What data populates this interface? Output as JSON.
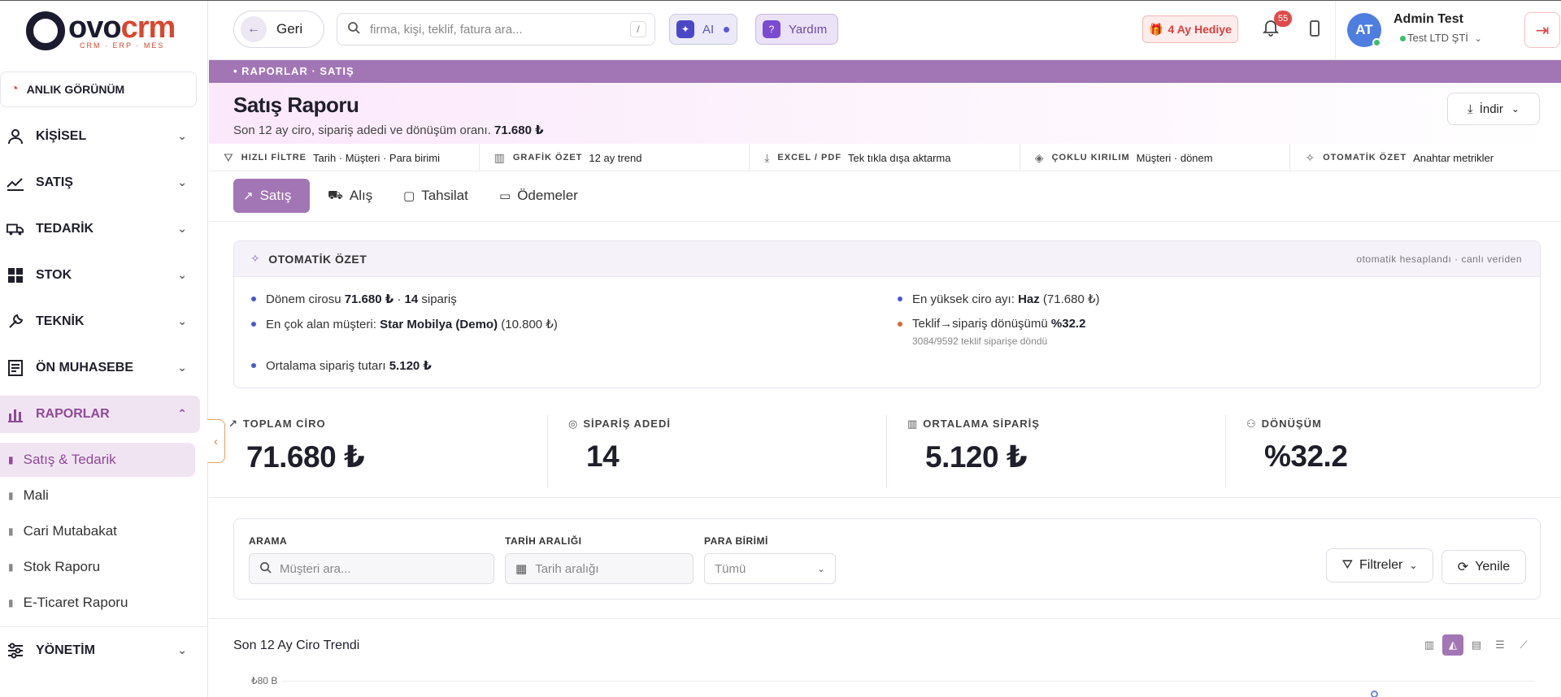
{
  "logo": {
    "main_left": "ovo",
    "main_right": "crm",
    "sub": "CRM · ERP · MES"
  },
  "sidebar": {
    "anlik_label": "ANLIK GÖRÜNÜM",
    "items": [
      {
        "label": "KİŞİSEL"
      },
      {
        "label": "SATIŞ"
      },
      {
        "label": "TEDARİK"
      },
      {
        "label": "STOK"
      },
      {
        "label": "TEKNİK"
      },
      {
        "label": "ÖN MUHASEBE"
      },
      {
        "label": "RAPORLAR"
      },
      {
        "label": "YÖNETİM"
      }
    ],
    "sub_items": [
      {
        "label": "Satış & Tedarik"
      },
      {
        "label": "Mali"
      },
      {
        "label": "Cari Mutabakat"
      },
      {
        "label": "Stok Raporu"
      },
      {
        "label": "E-Ticaret Raporu"
      }
    ]
  },
  "topbar": {
    "back_label": "Geri",
    "search_placeholder": "firma, kişi, teklif, fatura ara...",
    "search_shortcut": "/",
    "ai_label": "AI",
    "help_label": "Yardım",
    "gift_label": "4 Ay Hediye",
    "notification_count": "55",
    "avatar_initials": "AT",
    "user_name": "Admin Test",
    "company": "Test LTD ŞTİ"
  },
  "breadcrumb": "• RAPORLAR · SATIŞ",
  "header": {
    "title": "Satış Raporu",
    "subtitle": "Son 12 ay ciro, sipariş adedi ve dönüşüm oranı.",
    "subtitle_value": "71.680 ₺",
    "download_label": "İndir"
  },
  "features": [
    {
      "label": "HIZLI FİLTRE",
      "value": "Tarih · Müşteri · Para birimi"
    },
    {
      "label": "GRAFİK ÖZET",
      "value": "12 ay trend"
    },
    {
      "label": "EXCEL / PDF",
      "value": "Tek tıkla dışa aktarma"
    },
    {
      "label": "ÇOKLU KIRILIM",
      "value": "Müşteri · dönem"
    },
    {
      "label": "OTOMATİK ÖZET",
      "value": "Anahtar metrikler"
    }
  ],
  "tabs": [
    {
      "label": "Satış"
    },
    {
      "label": "Alış"
    },
    {
      "label": "Tahsilat"
    },
    {
      "label": "Ödemeler"
    }
  ],
  "summary": {
    "title": "OTOMATİK ÖZET",
    "note": "otomatik hesaplandı · canlı veriden",
    "b1_pre": "Dönem cirosu ",
    "b1_val": "71.680 ₺",
    "b1_mid": " · ",
    "b1_cnt": "14",
    "b1_post": " sipariş",
    "b2_pre": "En çok alan müşteri: ",
    "b2_val": "Star Mobilya (Demo)",
    "b2_post": " (10.800 ₺)",
    "b3_pre": "Ortalama sipariş tutarı ",
    "b3_val": "5.120 ₺",
    "b4_pre": "En yüksek ciro ayı: ",
    "b4_val": "Haz",
    "b4_post": " (71.680 ₺)",
    "b5_pre": "Teklif→sipariş dönüşümü ",
    "b5_val": "%32.2",
    "b5_sub": "3084/9592 teklif siparişe döndü"
  },
  "kpis": [
    {
      "label": "TOPLAM CİRO",
      "value": "71.680 ₺"
    },
    {
      "label": "SİPARİŞ ADEDİ",
      "value": "14"
    },
    {
      "label": "ORTALAMA SİPARİŞ",
      "value": "5.120 ₺"
    },
    {
      "label": "DÖNÜŞÜM",
      "value": "%32.2"
    }
  ],
  "filters": {
    "search_label": "ARAMA",
    "search_placeholder": "Müşteri ara...",
    "date_label": "TARİH ARALIĞI",
    "date_placeholder": "Tarih aralığı",
    "currency_label": "PARA BİRİMİ",
    "currency_value": "Tümü",
    "filters_btn": "Filtreler",
    "refresh_btn": "Yenile"
  },
  "chart": {
    "title": "Son 12 Ay Ciro Trendi",
    "ytick_top": "₺80 B"
  }
}
